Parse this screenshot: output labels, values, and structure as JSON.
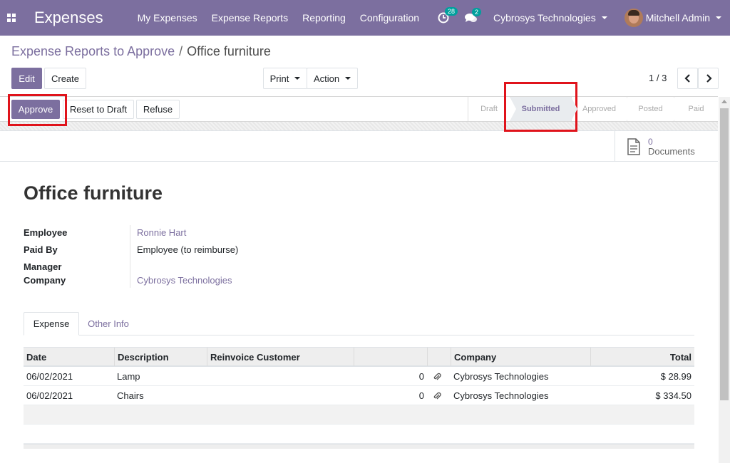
{
  "navbar": {
    "brand": "Expenses",
    "menu": [
      "My Expenses",
      "Expense Reports",
      "Reporting",
      "Configuration"
    ],
    "activity_count": "28",
    "message_count": "2",
    "company": "Cybrosys Technologies",
    "user": "Mitchell Admin",
    "accent_color": "#7c6f9f",
    "badge_color": "#00a09d"
  },
  "breadcrumb": {
    "parent": "Expense Reports to Approve",
    "separator": "/",
    "current": "Office furniture"
  },
  "controls": {
    "edit": "Edit",
    "create": "Create",
    "print": "Print",
    "action": "Action",
    "pager": "1 / 3"
  },
  "statusbar": {
    "approve": "Approve",
    "reset": "Reset to Draft",
    "refuse": "Refuse",
    "stages": [
      "Draft",
      "Submitted",
      "Approved",
      "Posted",
      "Paid"
    ],
    "current_stage": "Submitted"
  },
  "documents": {
    "count": "0",
    "label": "Documents"
  },
  "form": {
    "title": "Office furniture",
    "fields": {
      "employee_label": "Employee",
      "employee_value": "Ronnie Hart",
      "paid_by_label": "Paid By",
      "paid_by_value": "Employee (to reimburse)",
      "manager_label": "Manager",
      "company_label": "Company",
      "company_value": "Cybrosys Technologies"
    }
  },
  "tabs": [
    "Expense",
    "Other Info"
  ],
  "table": {
    "headers": [
      "Date",
      "Description",
      "Reinvoice Customer",
      "",
      "",
      "Company",
      "Total"
    ],
    "rows": [
      {
        "date": "06/02/2021",
        "description": "Lamp",
        "attachments": "0",
        "company": "Cybrosys Technologies",
        "total": "$ 28.99"
      },
      {
        "date": "06/02/2021",
        "description": "Chairs",
        "attachments": "0",
        "company": "Cybrosys Technologies",
        "total": "$ 334.50"
      }
    ]
  },
  "highlight_color": "#e0131b"
}
